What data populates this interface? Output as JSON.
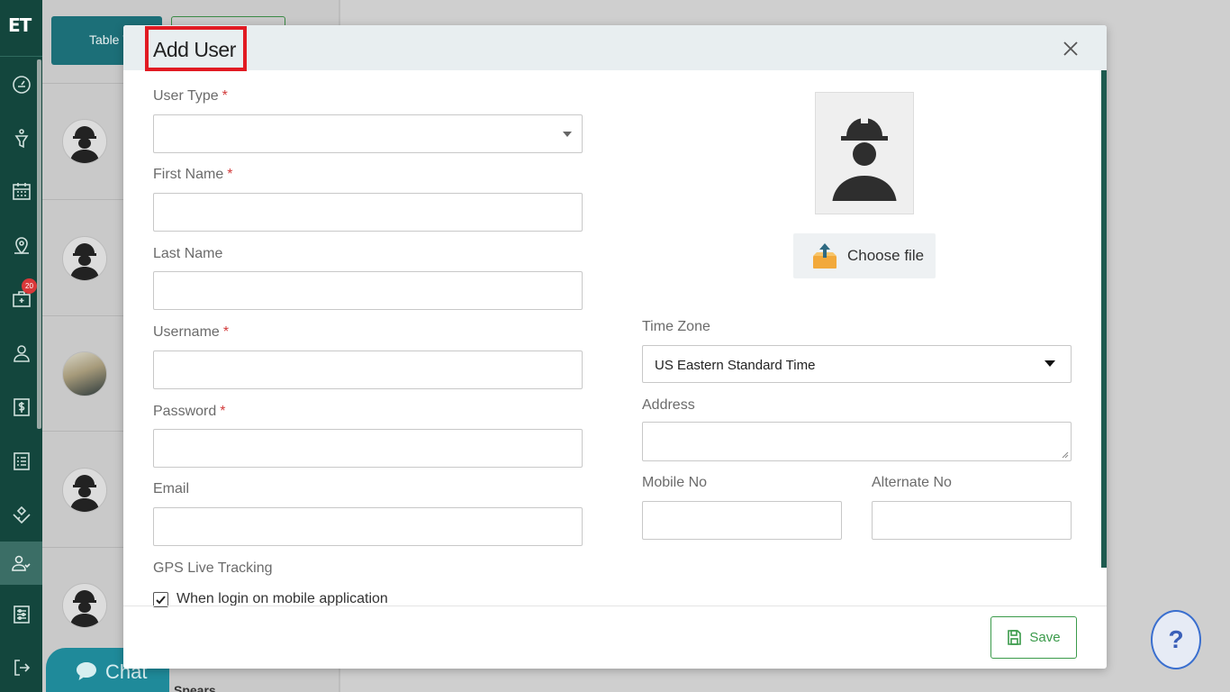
{
  "sidebar": {
    "logo": "ET",
    "badge_count": "20",
    "items": [
      {
        "icon": "dashboard-icon"
      },
      {
        "icon": "funnel-icon"
      },
      {
        "icon": "calendar-icon"
      },
      {
        "icon": "map-pin-icon"
      },
      {
        "icon": "briefcase-icon"
      },
      {
        "icon": "user-icon"
      },
      {
        "icon": "dollar-icon"
      },
      {
        "icon": "list-icon"
      },
      {
        "icon": "handshake-icon"
      },
      {
        "icon": "users-icon"
      },
      {
        "icon": "settings-sliders-icon"
      },
      {
        "icon": "logout-icon"
      }
    ]
  },
  "background": {
    "table_view_label": "Table V",
    "chat_label": "Chat",
    "partial_name": "Spears",
    "help_label": "?"
  },
  "modal": {
    "title": "Add User",
    "fields": {
      "user_type": {
        "label": "User Type",
        "value": ""
      },
      "first_name": {
        "label": "First Name",
        "value": ""
      },
      "last_name": {
        "label": "Last Name",
        "value": ""
      },
      "username": {
        "label": "Username",
        "value": ""
      },
      "password": {
        "label": "Password",
        "value": ""
      },
      "email": {
        "label": "Email",
        "value": ""
      },
      "gps_tracking": {
        "label": "GPS Live Tracking",
        "option": "When login on mobile application",
        "checked": true
      },
      "time_zone": {
        "label": "Time Zone",
        "value": "US Eastern Standard Time"
      },
      "address": {
        "label": "Address",
        "value": ""
      },
      "mobile_no": {
        "label": "Mobile No",
        "value": ""
      },
      "alternate_no": {
        "label": "Alternate No",
        "value": ""
      }
    },
    "required_mark": "*",
    "choose_file_label": "Choose file",
    "save_label": "Save"
  },
  "colors": {
    "sidebar": "#13463d",
    "accent": "#3a9a4a",
    "required": "#d23b3b",
    "title_highlight": "#e11a22"
  }
}
